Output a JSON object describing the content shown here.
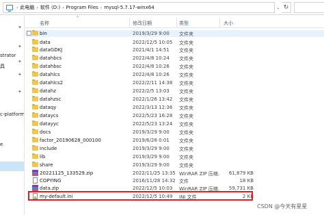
{
  "breadcrumb": [
    "此电脑",
    "软件 (D:)",
    "Program Files",
    "mysql-5.7.17-winx64"
  ],
  "columns": {
    "name": "名称",
    "date": "修改日期",
    "type": "类型",
    "size": "大小"
  },
  "nav": {
    "items": [
      "strator",
      "具",
      "c-platform",
      "e"
    ]
  },
  "files": [
    {
      "icon": "folder",
      "name": "bin",
      "date": "2019/3/29 9:00",
      "type": "文件夹",
      "size": ""
    },
    {
      "icon": "folder",
      "name": "data",
      "date": "2022/12/5 10:05",
      "type": "文件夹",
      "size": ""
    },
    {
      "icon": "folder",
      "name": "dataGDKJ",
      "date": "2021/4/1 14:51",
      "type": "文件夹",
      "size": ""
    },
    {
      "icon": "folder",
      "name": "datahbcs",
      "date": "2022/4/8 10:24",
      "type": "文件夹",
      "size": ""
    },
    {
      "icon": "folder",
      "name": "datahbsc",
      "date": "2022/4/8 10:26",
      "type": "文件夹",
      "size": ""
    },
    {
      "icon": "folder",
      "name": "datahlcs",
      "date": "2022/4/8 10:26",
      "type": "文件夹",
      "size": ""
    },
    {
      "icon": "folder",
      "name": "datahlcs2",
      "date": "2022/2/11 14:38",
      "type": "文件夹",
      "size": ""
    },
    {
      "icon": "folder",
      "name": "datahz",
      "date": "2022/2/5 13:03",
      "type": "文件夹",
      "size": ""
    },
    {
      "icon": "folder",
      "name": "datahzsc",
      "date": "2022/1/26 13:42",
      "type": "文件夹",
      "size": ""
    },
    {
      "icon": "folder",
      "name": "dataqy",
      "date": "2022/3/13 12:36",
      "type": "文件夹",
      "size": ""
    },
    {
      "icon": "folder",
      "name": "dataycs",
      "date": "2022/5/23 16:28",
      "type": "文件夹",
      "size": ""
    },
    {
      "icon": "folder",
      "name": "datayyc",
      "date": "2022/5/23 13:24",
      "type": "文件夹",
      "size": ""
    },
    {
      "icon": "folder",
      "name": "docs",
      "date": "2019/3/29 9:00",
      "type": "文件夹",
      "size": ""
    },
    {
      "icon": "folder",
      "name": "factor_20190628_000100",
      "date": "2019/6/28 0:01",
      "type": "文件夹",
      "size": ""
    },
    {
      "icon": "folder",
      "name": "include",
      "date": "2019/3/29 9:00",
      "type": "文件夹",
      "size": ""
    },
    {
      "icon": "folder",
      "name": "lib",
      "date": "2019/3/29 9:00",
      "type": "文件夹",
      "size": ""
    },
    {
      "icon": "folder",
      "name": "share",
      "date": "2019/3/29 9:00",
      "type": "文件夹",
      "size": ""
    },
    {
      "icon": "zip",
      "name": "20221125_133529.zip",
      "date": "2022/11/25 13:35",
      "type": "WinRAR ZIP 压缩...",
      "size": "61,879 KB"
    },
    {
      "icon": "file",
      "name": "COPYING",
      "date": "2016/11/28 14:32",
      "type": "文件",
      "size": "18 KB"
    },
    {
      "icon": "zip",
      "name": "data.zip",
      "date": "2022/12/5 10:03",
      "type": "WinRAR ZIP 压缩...",
      "size": "59,731 KB"
    },
    {
      "icon": "ini",
      "name": "my-default.ini",
      "date": "2022/12/5 10:49",
      "type": "INI 文件",
      "size": "2 KB"
    }
  ],
  "watermark": "CSDN @今天有星星"
}
